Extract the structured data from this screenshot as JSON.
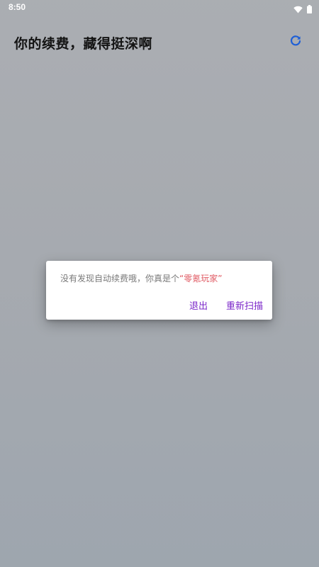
{
  "status_bar": {
    "time": "8:50",
    "icons": [
      "wifi-icon",
      "battery-icon"
    ]
  },
  "header": {
    "title": "你的续费，藏得挺深啊",
    "refresh_icon": "refresh-icon"
  },
  "dialog": {
    "message_prefix": "没有发现自动续费哦，你真是个",
    "message_highlight": "“零氪玩家”",
    "exit_label": "退出",
    "rescan_label": "重新扫描"
  },
  "colors": {
    "accent": "#7b27c9",
    "highlight": "#e05a63",
    "refresh_icon": "#1e5fd6",
    "scrim": "#a3a7ad"
  }
}
